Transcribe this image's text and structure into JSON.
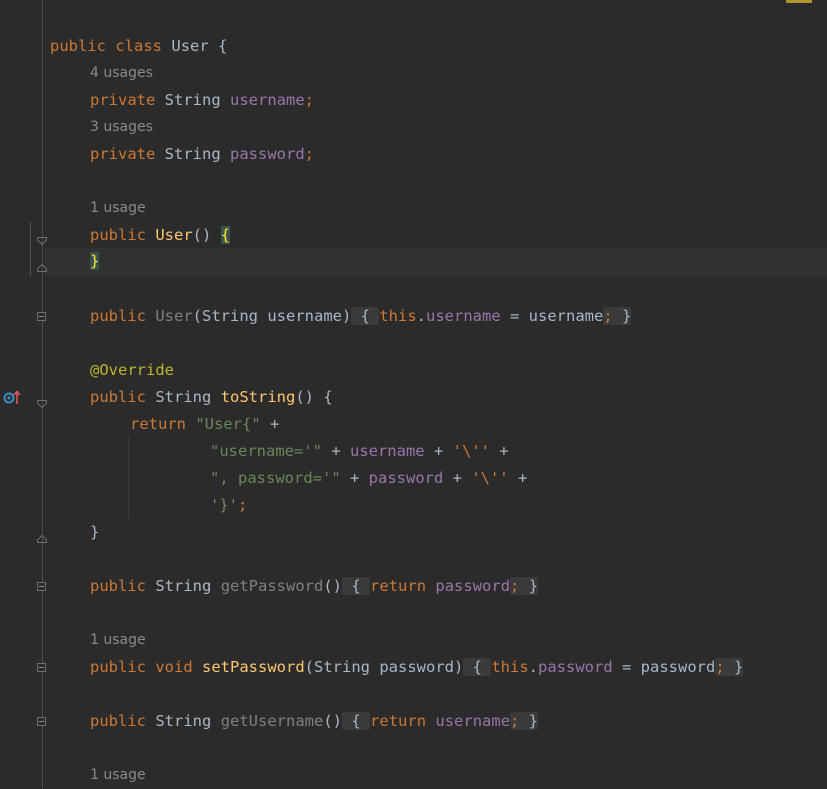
{
  "code": {
    "class_line": {
      "kw1": "public",
      "kw2": "class",
      "name": "User",
      "brace": "{"
    },
    "hints": {
      "username_usages": "4 usages",
      "password_usages": "3 usages",
      "ctor_usage": "1 usage",
      "setpw_usage": "1 usage",
      "last_usage": "1 usage"
    },
    "field_username": {
      "kw": "private",
      "type": "String",
      "name": "username",
      "semi": ";"
    },
    "field_password": {
      "kw": "private",
      "type": "String",
      "name": "password",
      "semi": ";"
    },
    "ctor_default": {
      "kw": "public",
      "name": "User",
      "parens": "()",
      "open": "{",
      "close": "}"
    },
    "ctor_arg": {
      "kw": "public",
      "name": "User",
      "params": "(String username)",
      "open": "{",
      "this": "this",
      "field": "username",
      "assign": " = username",
      "semi": ";",
      "close": "}"
    },
    "annotation": "@Override",
    "tostring": {
      "kw": "public",
      "type": "String",
      "name": "toString",
      "parens": "()",
      "open": "{",
      "ret": "return",
      "s1": "\"User{\"",
      "plus": " +",
      "s2": "\"username='\"",
      "f2": "username",
      "c2": "'\\''",
      "s3": "\", password='\"",
      "f3": "password",
      "c3": "'\\''",
      "c4": "'}'",
      "semi": ";",
      "close": "}"
    },
    "get_password": {
      "kw": "public",
      "type": "String",
      "name": "getPassword",
      "parens": "()",
      "open": "{",
      "ret": "return",
      "field": "password",
      "semi": ";",
      "close": "}"
    },
    "set_password": {
      "kw1": "public",
      "kw2": "void",
      "name": "setPassword",
      "params": "(String password)",
      "open": "{",
      "this": "this",
      "field": "password",
      "assign": " = password",
      "semi": ";",
      "close": "}"
    },
    "get_username": {
      "kw": "public",
      "type": "String",
      "name": "getUsername",
      "parens": "()",
      "open": "{",
      "ret": "return",
      "field": "username",
      "semi": ";",
      "close": "}"
    }
  },
  "colors": {
    "background": "#2b2b2b",
    "keyword": "#cc7832",
    "field": "#9876aa",
    "string": "#6a8759",
    "method": "#ffc66d",
    "annotation": "#bbb529",
    "text": "#a9b7c6"
  },
  "icons": [
    "fold-marker-icon",
    "override-method-icon"
  ]
}
